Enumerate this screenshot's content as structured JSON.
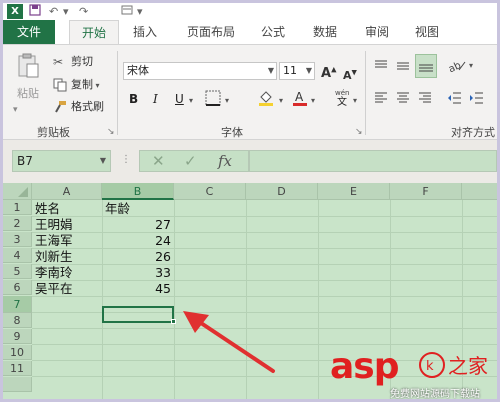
{
  "quick_access": {
    "app_logo": "X"
  },
  "tabs": [
    "文件",
    "开始",
    "插入",
    "页面布局",
    "公式",
    "数据",
    "审阅",
    "视图"
  ],
  "ribbon": {
    "clipboard": {
      "paste": "粘贴",
      "cut": "剪切",
      "copy": "复制",
      "format_painter": "格式刷",
      "label": "剪贴板"
    },
    "font": {
      "name": "宋体",
      "size": "11",
      "label": "字体",
      "bold": "B",
      "italic": "I",
      "underline": "U"
    },
    "alignment": {
      "label": "对齐方式"
    }
  },
  "formula_bar": {
    "name_box": "B7",
    "fx": "fx",
    "cancel": "✕",
    "enter": "✓",
    "formula": ""
  },
  "grid": {
    "columns": [
      "A",
      "B",
      "C",
      "D",
      "E",
      "F"
    ],
    "rows": [
      "1",
      "2",
      "3",
      "4",
      "5",
      "6",
      "7",
      "8",
      "9",
      "10",
      "11"
    ],
    "header_row": [
      "姓名",
      "年龄"
    ],
    "data": [
      [
        "王明娟",
        "27"
      ],
      [
        "王海军",
        "24"
      ],
      [
        "刘新生",
        "26"
      ],
      [
        "李南玲",
        "33"
      ],
      [
        "吴平在",
        "45"
      ]
    ],
    "active_cell": "B7"
  },
  "watermark": {
    "brand": "asp",
    "sub": "免费网站源码下载站"
  },
  "colors": {
    "accent": "#217346",
    "grid_bg": "#c9e4c9",
    "arrow": "#e03030"
  }
}
